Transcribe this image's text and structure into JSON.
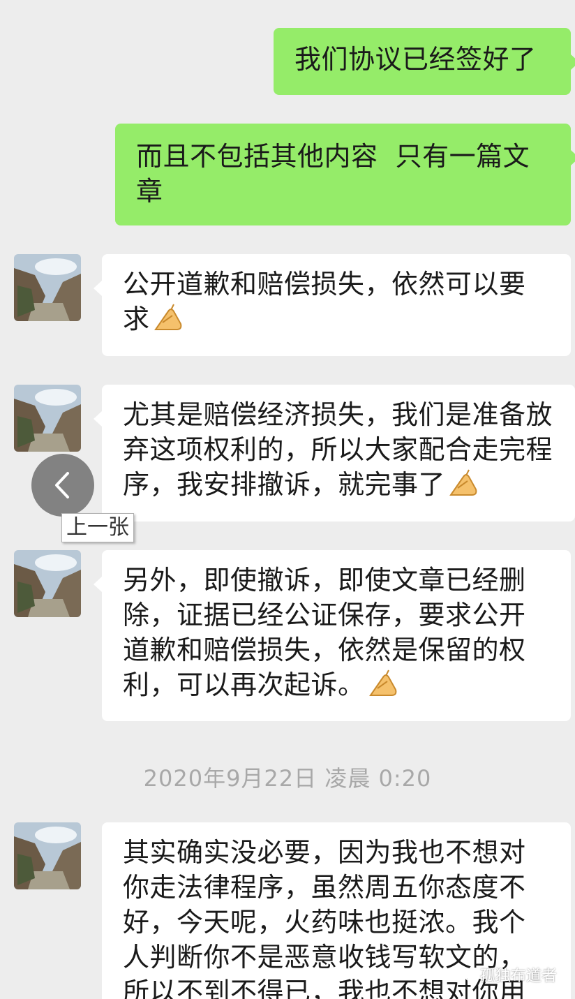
{
  "messages": [
    {
      "side": "sent",
      "text": "我们协议已经签好了"
    },
    {
      "side": "sent",
      "text": "而且不包括其他内容  只有一篇文章"
    },
    {
      "side": "received",
      "text": "公开道歉和赔偿损失，依然可以要求",
      "emoji": "hands-icon"
    },
    {
      "side": "received",
      "text": "尤其是赔偿经济损失，我们是准备放弃这项权利的，所以大家配合走完程序，我安排撤诉，就完事了",
      "emoji": "hands-icon"
    },
    {
      "side": "received",
      "text": "另外，即使撤诉，即使文章已经删除，证据已经公证保存，要求公开道歉和赔偿损失，依然是保留的权利，可以再次起诉。",
      "emoji": "hands-icon"
    },
    {
      "side": "received",
      "text": "其实确实没必要，因为我也不想对你走法律程序，虽然周五你态度不好，今天呢，火药味也挺浓。我个人判断你不是恶意收钱写软文的，所以不到不得已，我也不想对你用"
    }
  ],
  "timestamp": "2020年9月22日 凌晨 0:20",
  "viewer": {
    "prev_tooltip": "上一张",
    "prev_icon": "chevron-left-icon"
  },
  "watermark": "孤独布道者",
  "colors": {
    "background": "#ededed",
    "sent_bubble": "#95ec69",
    "received_bubble": "#ffffff"
  }
}
